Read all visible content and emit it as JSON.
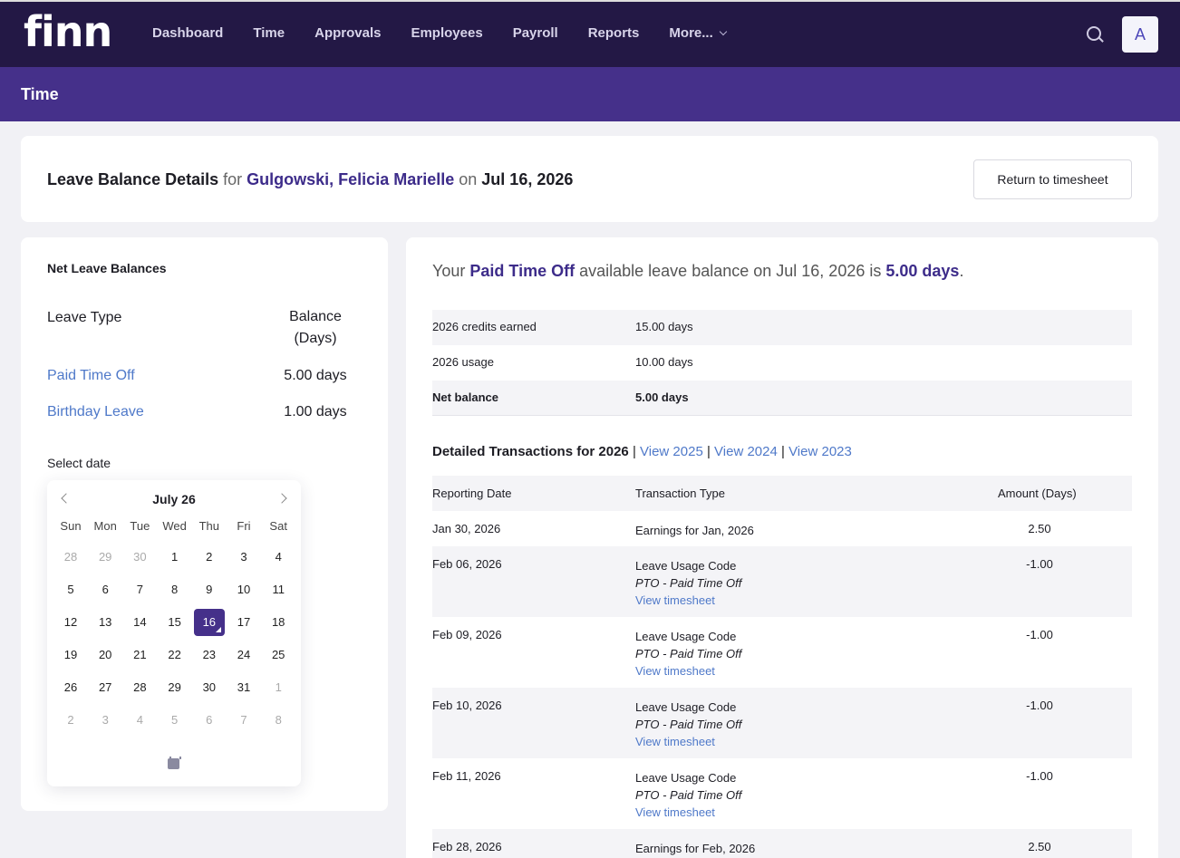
{
  "nav": {
    "logo": "finn",
    "items": [
      "Dashboard",
      "Time",
      "Approvals",
      "Employees",
      "Payroll",
      "Reports",
      "More..."
    ],
    "avatar_letter": "A"
  },
  "subbar": {
    "title": "Time"
  },
  "header": {
    "title_prefix": "Leave Balance Details",
    "for": "for",
    "person": "Gulgowski, Felicia Marielle",
    "on": "on",
    "date": "Jul 16, 2026",
    "return_label": "Return to timesheet"
  },
  "net_balances": {
    "title": "Net Leave Balances",
    "col_type": "Leave Type",
    "col_balance": "Balance (Days)",
    "rows": [
      {
        "name": "Paid Time Off",
        "value": "5.00 days"
      },
      {
        "name": "Birthday Leave",
        "value": "1.00 days"
      }
    ],
    "select_date_label": "Select date"
  },
  "calendar": {
    "title": "July 26",
    "weekdays": [
      "Sun",
      "Mon",
      "Tue",
      "Wed",
      "Thu",
      "Fri",
      "Sat"
    ],
    "weeks": [
      [
        "28",
        "29",
        "30",
        "1",
        "2",
        "3",
        "4"
      ],
      [
        "5",
        "6",
        "7",
        "8",
        "9",
        "10",
        "11"
      ],
      [
        "12",
        "13",
        "14",
        "15",
        "16",
        "17",
        "18"
      ],
      [
        "19",
        "20",
        "21",
        "22",
        "23",
        "24",
        "25"
      ],
      [
        "26",
        "27",
        "28",
        "29",
        "30",
        "31",
        "1"
      ],
      [
        "2",
        "3",
        "4",
        "5",
        "6",
        "7",
        "8"
      ]
    ],
    "selected": "16"
  },
  "summary": {
    "part1": "Your",
    "leave_type": "Paid Time Off",
    "part2": "available leave balance on Jul 16, 2026 is",
    "amount": "5.00 days",
    "part3": "."
  },
  "balance_rows": [
    {
      "label": "2026 credits earned",
      "value": "15.00 days"
    },
    {
      "label": "2026 usage",
      "value": "10.00 days"
    },
    {
      "label": "Net balance",
      "value": "5.00 days"
    }
  ],
  "transactions": {
    "title": "Detailed Transactions for 2026",
    "sep": "|",
    "links": [
      "View 2025",
      "View 2024",
      "View 2023"
    ],
    "headers": [
      "Reporting Date",
      "Transaction Type",
      "Amount (Days)"
    ],
    "rows": [
      {
        "date": "Jan 30, 2026",
        "type": "Earnings for Jan, 2026",
        "code": "",
        "link": "",
        "amount": "2.50"
      },
      {
        "date": "Feb 06, 2026",
        "type": "Leave Usage Code",
        "code": "PTO - Paid Time Off",
        "link": "View timesheet",
        "amount": "-1.00"
      },
      {
        "date": "Feb 09, 2026",
        "type": "Leave Usage Code",
        "code": "PTO - Paid Time Off",
        "link": "View timesheet",
        "amount": "-1.00"
      },
      {
        "date": "Feb 10, 2026",
        "type": "Leave Usage Code",
        "code": "PTO - Paid Time Off",
        "link": "View timesheet",
        "amount": "-1.00"
      },
      {
        "date": "Feb 11, 2026",
        "type": "Leave Usage Code",
        "code": "PTO - Paid Time Off",
        "link": "View timesheet",
        "amount": "-1.00"
      },
      {
        "date": "Feb 28, 2026",
        "type": "Earnings for Feb, 2026",
        "code": "",
        "link": "",
        "amount": "2.50"
      }
    ]
  }
}
